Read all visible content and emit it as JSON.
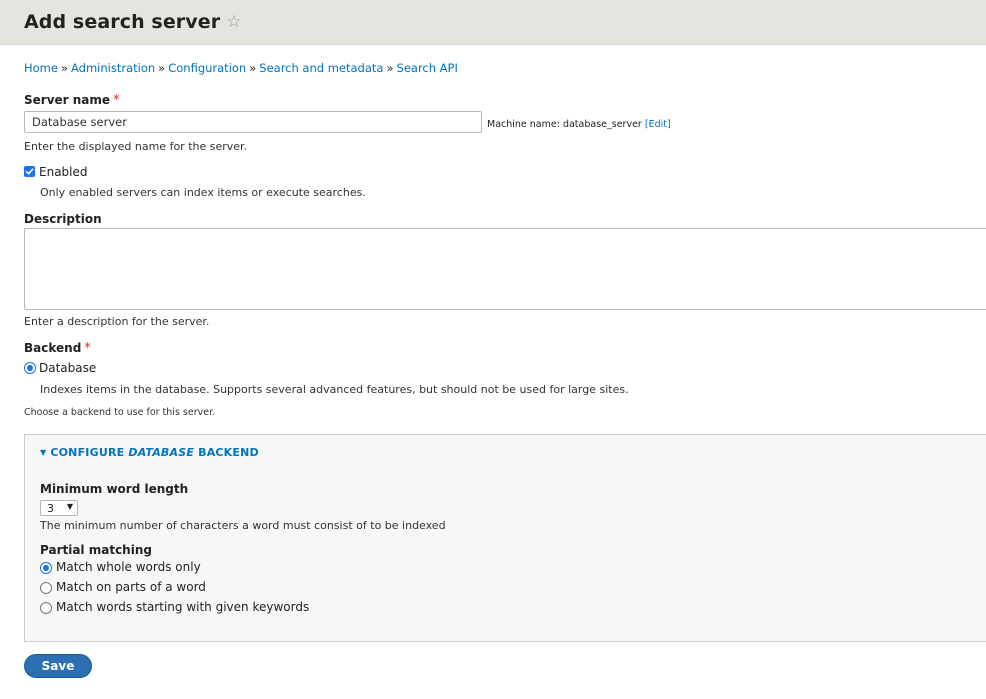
{
  "header": {
    "title": "Add search server",
    "star_glyph": "☆"
  },
  "breadcrumb": {
    "items": [
      "Home",
      "Administration",
      "Configuration",
      "Search and metadata",
      "Search API"
    ],
    "separator": "»"
  },
  "server_name": {
    "label": "Server name",
    "required_mark": "*",
    "value": "Database server",
    "help": "Enter the displayed name for the server.",
    "machine_name_prefix": "Machine name: database_server",
    "machine_name_edit": "[Edit]"
  },
  "enabled": {
    "label": "Enabled",
    "checked": true,
    "help": "Only enabled servers can index items or execute searches."
  },
  "description": {
    "label": "Description",
    "value": "",
    "help": "Enter a description for the server."
  },
  "backend": {
    "label": "Backend",
    "required_mark": "*",
    "option": "Database",
    "option_help": "Indexes items in the database. Supports several advanced features, but should not be used for large sites.",
    "help": "Choose a backend to use for this server."
  },
  "configure": {
    "summary_prefix": "CONFIGURE",
    "summary_em": "DATABASE",
    "summary_suffix": "BACKEND",
    "min_word_length": {
      "label": "Minimum word length",
      "value": "3",
      "help": "The minimum number of characters a word must consist of to be indexed"
    },
    "partial_matching": {
      "label": "Partial matching",
      "options": [
        "Match whole words only",
        "Match on parts of a word",
        "Match words starting with given keywords"
      ],
      "selected_index": 0
    }
  },
  "actions": {
    "save_label": "Save"
  },
  "colors": {
    "link": "#0074bd",
    "accent": "#1a73e8",
    "required": "#e3262d",
    "button": "#2c6fb3",
    "header_bg": "#e5e4df"
  }
}
